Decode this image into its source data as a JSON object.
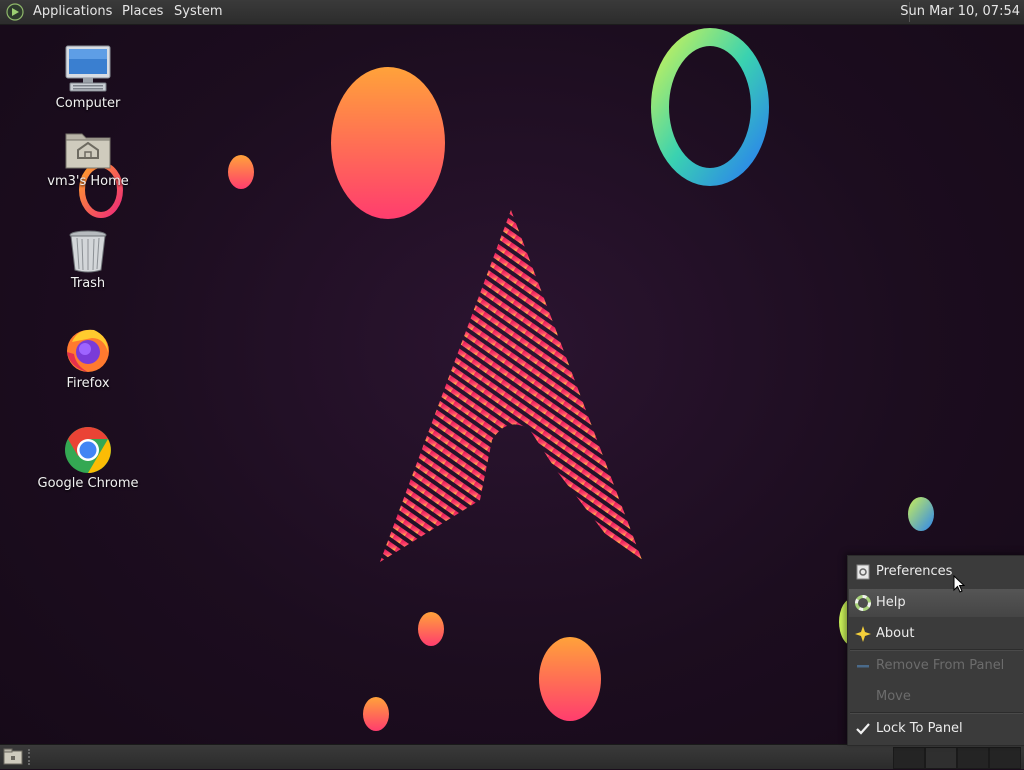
{
  "top_panel": {
    "menus": [
      "Applications",
      "Places",
      "System"
    ],
    "clock": "Sun Mar 10, 07:54"
  },
  "desktop_icons": [
    {
      "label": "Computer",
      "icon": "computer-icon"
    },
    {
      "label": "vm3's Home",
      "icon": "home-folder-icon"
    },
    {
      "label": "Trash",
      "icon": "trash-icon"
    },
    {
      "label": "Firefox",
      "icon": "firefox-icon"
    },
    {
      "label": "Google Chrome",
      "icon": "chrome-icon"
    }
  ],
  "context_menu": {
    "items": [
      {
        "label": "Preferences",
        "icon": "preferences-icon",
        "enabled": true
      },
      {
        "label": "Help",
        "icon": "help-icon",
        "enabled": true
      },
      {
        "label": "About",
        "icon": "about-icon",
        "enabled": true
      },
      {
        "label": "Remove From Panel",
        "icon": "remove-icon",
        "enabled": false
      },
      {
        "label": "Move",
        "icon": "",
        "enabled": false
      },
      {
        "label": "Lock To Panel",
        "icon": "checkmark-icon",
        "enabled": true,
        "checked": true
      }
    ]
  },
  "colors": {
    "orange": "#ff8a3d",
    "pink": "#e8306e",
    "yellow": "#f5d03a",
    "panel": "#333333"
  }
}
